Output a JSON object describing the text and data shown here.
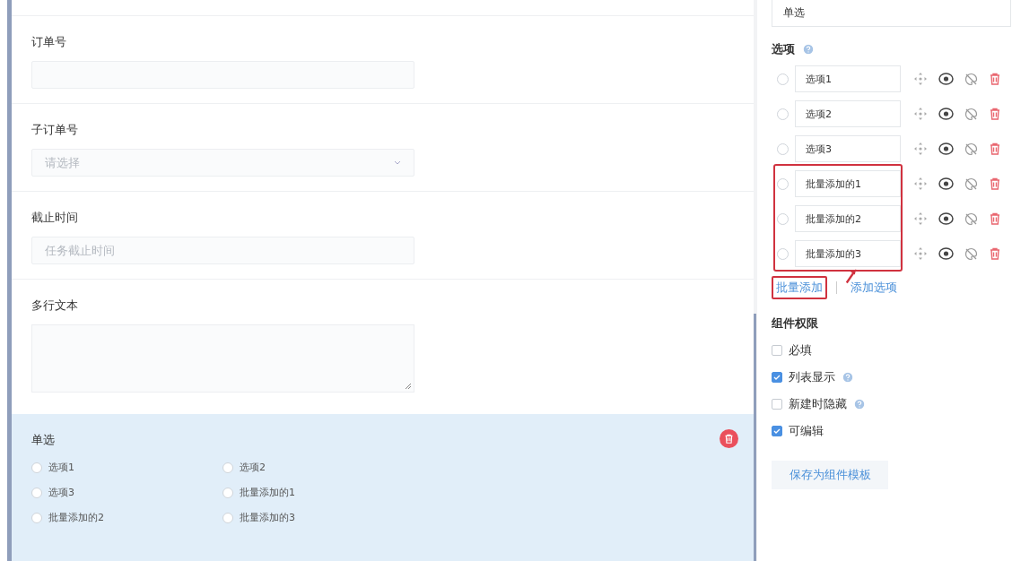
{
  "form": {
    "fields": [
      {
        "kind": "text",
        "label": "订单号"
      },
      {
        "kind": "select",
        "label": "子订单号",
        "placeholder": "请选择"
      },
      {
        "kind": "text",
        "label": "截止时间",
        "placeholder": "任务截止时间"
      },
      {
        "kind": "textarea",
        "label": "多行文本"
      }
    ],
    "radio_field": {
      "label": "单选",
      "selected": true,
      "options": [
        {
          "label": "选项1",
          "selected": false
        },
        {
          "label": "选项2",
          "selected": false
        },
        {
          "label": "选项3",
          "selected": false
        },
        {
          "label": "批量添加的1",
          "selected": false
        },
        {
          "label": "批量添加的2",
          "selected": false
        },
        {
          "label": "批量添加的3",
          "selected": false
        }
      ]
    }
  },
  "settings": {
    "title_value": "单选",
    "options_heading": "选项",
    "options": [
      {
        "value": "选项1",
        "selected": false,
        "highlighted": false
      },
      {
        "value": "选项2",
        "selected": false,
        "highlighted": false
      },
      {
        "value": "选项3",
        "selected": false,
        "highlighted": false
      },
      {
        "value": "批量添加的1",
        "selected": false,
        "highlighted": true
      },
      {
        "value": "批量添加的2",
        "selected": false,
        "highlighted": true
      },
      {
        "value": "批量添加的3",
        "selected": false,
        "highlighted": true
      }
    ],
    "links": [
      {
        "label": "批量添加",
        "highlighted": true
      },
      {
        "label": "添加选项",
        "highlighted": false
      }
    ],
    "permissions_heading": "组件权限",
    "permissions": [
      {
        "label": "必填",
        "checked": false,
        "help": false
      },
      {
        "label": "列表显示",
        "checked": true,
        "help": true
      },
      {
        "label": "新建时隐藏",
        "checked": false,
        "help": true
      },
      {
        "label": "可编辑",
        "checked": true,
        "help": false
      }
    ],
    "save_button": "保存为组件模板"
  }
}
